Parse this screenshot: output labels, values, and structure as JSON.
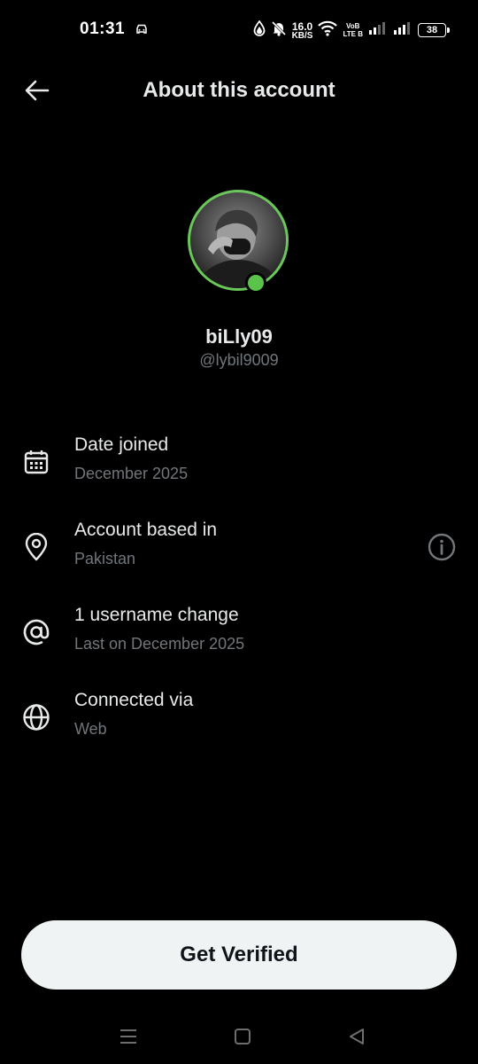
{
  "status_bar": {
    "time": "01:31",
    "speed_value": "16.0",
    "speed_unit": "KB/S",
    "volte_top": "VoB",
    "volte_bottom": "LTE B",
    "battery": "38"
  },
  "header": {
    "title": "About this account"
  },
  "profile": {
    "display_name": "biLly09",
    "handle": "@lybil9009"
  },
  "info_items": [
    {
      "title": "Date joined",
      "subtitle": "December 2025",
      "icon": "calendar-icon"
    },
    {
      "title": "Account based in",
      "subtitle": "Pakistan",
      "icon": "location-pin-icon",
      "extra_icon": "info-icon"
    },
    {
      "title": "1 username change",
      "subtitle": "Last on December 2025",
      "icon": "at-sign-icon"
    },
    {
      "title": "Connected via",
      "subtitle": "Web",
      "icon": "globe-icon"
    }
  ],
  "cta": {
    "label": "Get Verified"
  },
  "colors": {
    "background": "#000000",
    "primary_text": "#e7e9ea",
    "secondary_text": "#71767b",
    "button_bg": "#eff3f4",
    "button_text": "#0f1419",
    "online": "#5ac44a"
  }
}
